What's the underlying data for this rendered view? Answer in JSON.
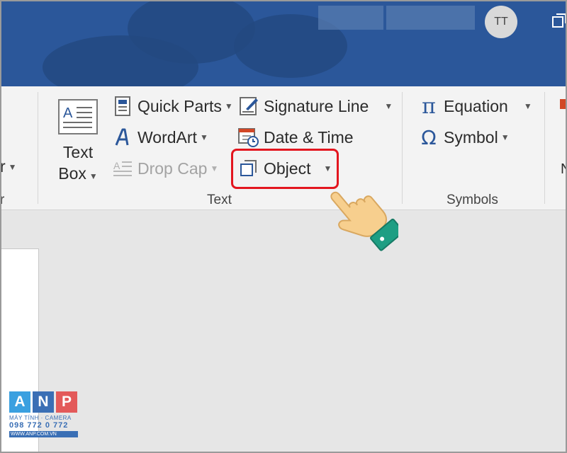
{
  "titlebar": {
    "avatar_initials": "TT",
    "color": "#2b579a"
  },
  "ribbon": {
    "left_partial": {
      "dropdown_label": "r",
      "group_label": "r"
    },
    "text_group": {
      "label": "Text",
      "text_box": {
        "line1": "Text",
        "line2": "Box",
        "icon": "text-box-icon"
      },
      "quick_parts": {
        "label": "Quick Parts",
        "icon": "quick-parts-icon"
      },
      "wordart": {
        "label": "WordArt",
        "icon": "wordart-icon"
      },
      "drop_cap": {
        "label": "Drop Cap",
        "icon": "drop-cap-icon",
        "disabled": true
      },
      "signature_line": {
        "label": "Signature Line",
        "icon": "signature-line-icon"
      },
      "date_time": {
        "label": "Date & Time",
        "icon": "date-time-icon"
      },
      "object": {
        "label": "Object",
        "icon": "object-icon",
        "highlighted": true
      }
    },
    "symbols_group": {
      "label": "Symbols",
      "equation": {
        "label": "Equation",
        "icon": "pi-icon",
        "glyph": "π"
      },
      "symbol": {
        "label": "Symbol",
        "icon": "omega-icon",
        "glyph": "Ω"
      }
    },
    "right_partial": {
      "label": "N"
    }
  },
  "colors": {
    "highlight": "#e3161f",
    "icon_blue": "#2b579a",
    "hand_skin": "#f7cf8e",
    "hand_cuff": "#1e9e83"
  },
  "watermark": {
    "letters": [
      "A",
      "N",
      "P"
    ],
    "letter_colors": [
      "#3aa0e0",
      "#3a6fb5",
      "#e35a5a"
    ],
    "tagline": "MÁY TÍNH · CAMERA",
    "phone": "098 772 0 772",
    "website": "WWW.ANP.COM.VN"
  }
}
